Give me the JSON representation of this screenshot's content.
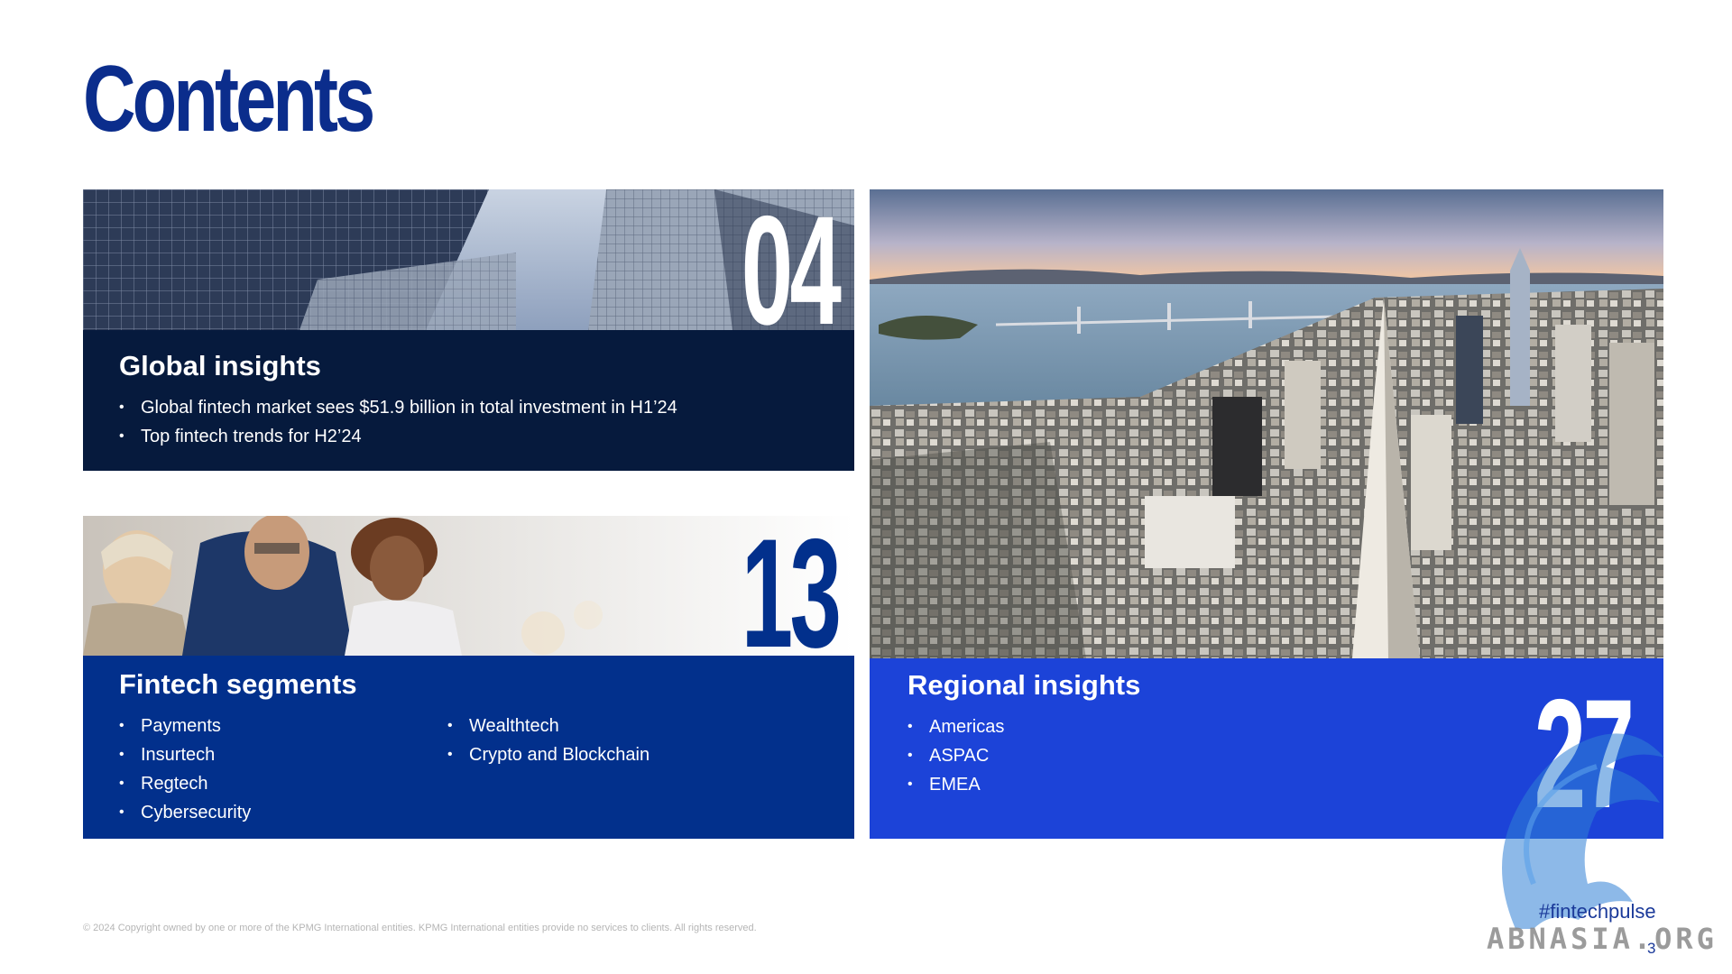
{
  "page": {
    "title": "Contents",
    "page_number": "3",
    "hashtag": "#fintechpulse",
    "copyright": "© 2024 Copyright owned by one or more of the KPMG International entities. KPMG International entities provide no services to clients. All rights reserved.",
    "watermark": "ABNASIA.ORG"
  },
  "colors": {
    "navy": "#061a3d",
    "royal": "#02308c",
    "bright": "#1c43d8",
    "title": "#0b2d8c"
  },
  "sections": {
    "global": {
      "number": "04",
      "heading": "Global insights",
      "bullets": [
        "Global fintech market sees $51.9 billion in total investment in H1’24",
        "Top fintech trends for H2’24"
      ]
    },
    "segments": {
      "number": "13",
      "heading": "Fintech segments",
      "bullets_col1": [
        "Payments",
        "Insurtech",
        "Regtech",
        "Cybersecurity"
      ],
      "bullets_col2": [
        "Wealthtech",
        "Crypto and Blockchain"
      ]
    },
    "regional": {
      "number": "27",
      "heading": "Regional insights",
      "bullets": [
        "Americas",
        "ASPAC",
        "EMEA"
      ]
    }
  }
}
